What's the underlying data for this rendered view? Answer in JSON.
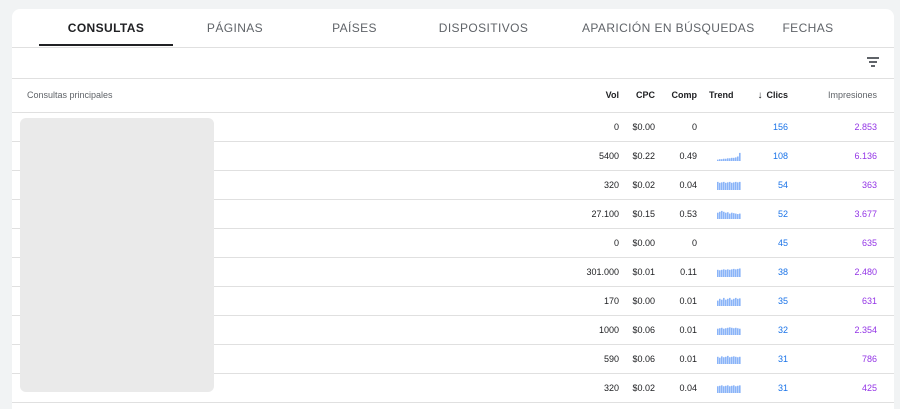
{
  "tabs": [
    {
      "label": "CONSULTAS",
      "active": true
    },
    {
      "label": "PÁGINAS",
      "active": false
    },
    {
      "label": "PAÍSES",
      "active": false
    },
    {
      "label": "DISPOSITIVOS",
      "active": false
    },
    {
      "label": "APARICIÓN EN BÚSQUEDAS",
      "active": false
    },
    {
      "label": "FECHAS",
      "active": false
    }
  ],
  "filter": {
    "icon": "filter-icon"
  },
  "table": {
    "headers": {
      "query": "Consultas principales",
      "vol": "Vol",
      "cpc": "CPC",
      "comp": "Comp",
      "trend": "Trend",
      "clics": "Clics",
      "impressions": "Impresiones",
      "sort_icon": "arrow-down-icon"
    },
    "rows": [
      {
        "vol": "0",
        "cpc": "$0.00",
        "comp": "0",
        "trend": [],
        "clics": "156",
        "impressions": "2.853"
      },
      {
        "vol": "5400",
        "cpc": "$0.22",
        "comp": "0.49",
        "trend": [
          0.15,
          0.2,
          0.2,
          0.25,
          0.25,
          0.3,
          0.3,
          0.35,
          0.35,
          0.4,
          0.5,
          0.9
        ],
        "clics": "108",
        "impressions": "6.136"
      },
      {
        "vol": "320",
        "cpc": "$0.02",
        "comp": "0.04",
        "trend": [
          0.9,
          0.8,
          0.85,
          0.9,
          0.8,
          0.85,
          0.9,
          0.8,
          0.85,
          0.9,
          0.85,
          0.9
        ],
        "clics": "54",
        "impressions": "363"
      },
      {
        "vol": "27.100",
        "cpc": "$0.15",
        "comp": "0.53",
        "trend": [
          0.7,
          0.8,
          0.9,
          0.8,
          0.7,
          0.75,
          0.6,
          0.7,
          0.65,
          0.6,
          0.55,
          0.6
        ],
        "clics": "52",
        "impressions": "3.677"
      },
      {
        "vol": "0",
        "cpc": "$0.00",
        "comp": "0",
        "trend": [],
        "clics": "45",
        "impressions": "635"
      },
      {
        "vol": "301.000",
        "cpc": "$0.01",
        "comp": "0.11",
        "trend": [
          0.8,
          0.75,
          0.8,
          0.85,
          0.8,
          0.85,
          0.8,
          0.85,
          0.9,
          0.85,
          0.9,
          0.95
        ],
        "clics": "38",
        "impressions": "2.480"
      },
      {
        "vol": "170",
        "cpc": "$0.00",
        "comp": "0.01",
        "trend": [
          0.6,
          0.8,
          0.7,
          0.9,
          0.7,
          0.8,
          0.9,
          0.7,
          0.8,
          0.9,
          0.8,
          0.85
        ],
        "clics": "35",
        "impressions": "631"
      },
      {
        "vol": "1000",
        "cpc": "$0.06",
        "comp": "0.01",
        "trend": [
          0.7,
          0.75,
          0.8,
          0.7,
          0.75,
          0.8,
          0.85,
          0.8,
          0.75,
          0.8,
          0.75,
          0.7
        ],
        "clics": "32",
        "impressions": "2.354"
      },
      {
        "vol": "590",
        "cpc": "$0.06",
        "comp": "0.01",
        "trend": [
          0.8,
          0.7,
          0.85,
          0.75,
          0.8,
          0.9,
          0.75,
          0.8,
          0.85,
          0.8,
          0.75,
          0.8
        ],
        "clics": "31",
        "impressions": "786"
      },
      {
        "vol": "320",
        "cpc": "$0.02",
        "comp": "0.04",
        "trend": [
          0.75,
          0.8,
          0.85,
          0.75,
          0.8,
          0.85,
          0.75,
          0.8,
          0.85,
          0.75,
          0.8,
          0.85
        ],
        "clics": "31",
        "impressions": "425"
      }
    ]
  },
  "colors": {
    "clics": "#1a73e8",
    "impressions": "#9334e6",
    "trend": "#8ab4f8"
  }
}
